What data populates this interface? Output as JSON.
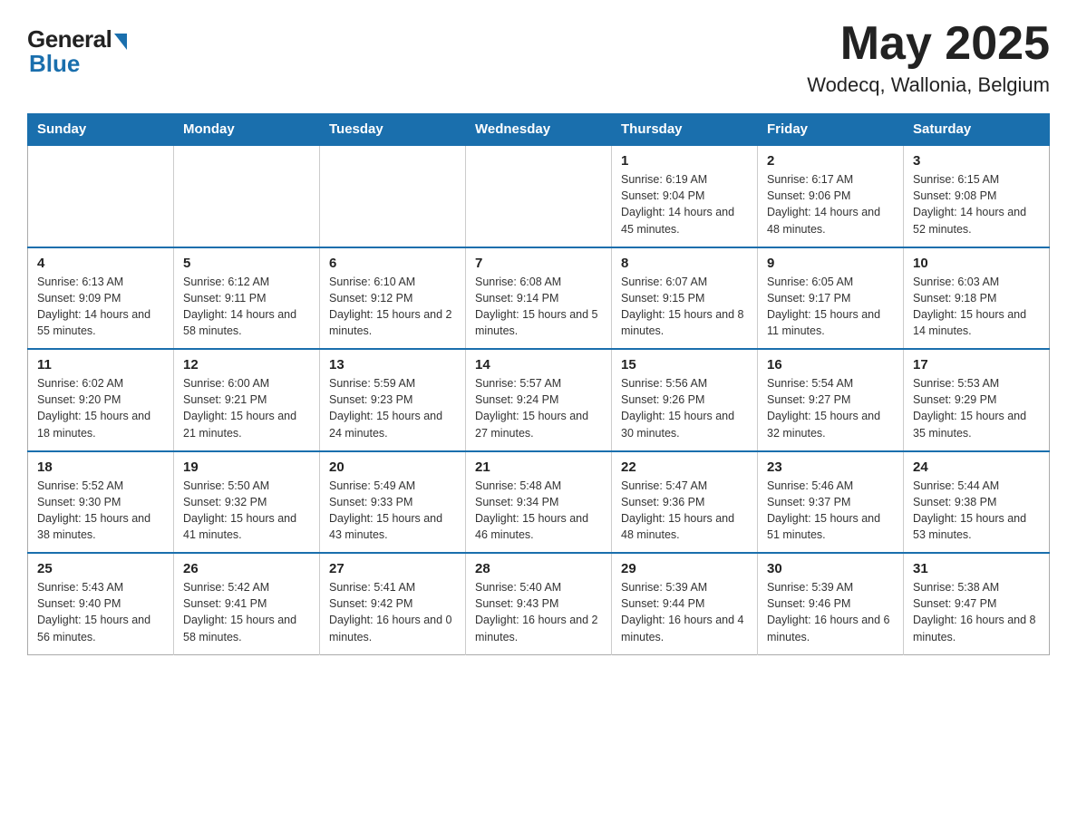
{
  "logo": {
    "general": "General",
    "blue": "Blue"
  },
  "title": {
    "month": "May 2025",
    "location": "Wodecq, Wallonia, Belgium"
  },
  "weekdays": [
    "Sunday",
    "Monday",
    "Tuesday",
    "Wednesday",
    "Thursday",
    "Friday",
    "Saturday"
  ],
  "weeks": [
    [
      {
        "day": "",
        "info": ""
      },
      {
        "day": "",
        "info": ""
      },
      {
        "day": "",
        "info": ""
      },
      {
        "day": "",
        "info": ""
      },
      {
        "day": "1",
        "info": "Sunrise: 6:19 AM\nSunset: 9:04 PM\nDaylight: 14 hours and 45 minutes."
      },
      {
        "day": "2",
        "info": "Sunrise: 6:17 AM\nSunset: 9:06 PM\nDaylight: 14 hours and 48 minutes."
      },
      {
        "day": "3",
        "info": "Sunrise: 6:15 AM\nSunset: 9:08 PM\nDaylight: 14 hours and 52 minutes."
      }
    ],
    [
      {
        "day": "4",
        "info": "Sunrise: 6:13 AM\nSunset: 9:09 PM\nDaylight: 14 hours and 55 minutes."
      },
      {
        "day": "5",
        "info": "Sunrise: 6:12 AM\nSunset: 9:11 PM\nDaylight: 14 hours and 58 minutes."
      },
      {
        "day": "6",
        "info": "Sunrise: 6:10 AM\nSunset: 9:12 PM\nDaylight: 15 hours and 2 minutes."
      },
      {
        "day": "7",
        "info": "Sunrise: 6:08 AM\nSunset: 9:14 PM\nDaylight: 15 hours and 5 minutes."
      },
      {
        "day": "8",
        "info": "Sunrise: 6:07 AM\nSunset: 9:15 PM\nDaylight: 15 hours and 8 minutes."
      },
      {
        "day": "9",
        "info": "Sunrise: 6:05 AM\nSunset: 9:17 PM\nDaylight: 15 hours and 11 minutes."
      },
      {
        "day": "10",
        "info": "Sunrise: 6:03 AM\nSunset: 9:18 PM\nDaylight: 15 hours and 14 minutes."
      }
    ],
    [
      {
        "day": "11",
        "info": "Sunrise: 6:02 AM\nSunset: 9:20 PM\nDaylight: 15 hours and 18 minutes."
      },
      {
        "day": "12",
        "info": "Sunrise: 6:00 AM\nSunset: 9:21 PM\nDaylight: 15 hours and 21 minutes."
      },
      {
        "day": "13",
        "info": "Sunrise: 5:59 AM\nSunset: 9:23 PM\nDaylight: 15 hours and 24 minutes."
      },
      {
        "day": "14",
        "info": "Sunrise: 5:57 AM\nSunset: 9:24 PM\nDaylight: 15 hours and 27 minutes."
      },
      {
        "day": "15",
        "info": "Sunrise: 5:56 AM\nSunset: 9:26 PM\nDaylight: 15 hours and 30 minutes."
      },
      {
        "day": "16",
        "info": "Sunrise: 5:54 AM\nSunset: 9:27 PM\nDaylight: 15 hours and 32 minutes."
      },
      {
        "day": "17",
        "info": "Sunrise: 5:53 AM\nSunset: 9:29 PM\nDaylight: 15 hours and 35 minutes."
      }
    ],
    [
      {
        "day": "18",
        "info": "Sunrise: 5:52 AM\nSunset: 9:30 PM\nDaylight: 15 hours and 38 minutes."
      },
      {
        "day": "19",
        "info": "Sunrise: 5:50 AM\nSunset: 9:32 PM\nDaylight: 15 hours and 41 minutes."
      },
      {
        "day": "20",
        "info": "Sunrise: 5:49 AM\nSunset: 9:33 PM\nDaylight: 15 hours and 43 minutes."
      },
      {
        "day": "21",
        "info": "Sunrise: 5:48 AM\nSunset: 9:34 PM\nDaylight: 15 hours and 46 minutes."
      },
      {
        "day": "22",
        "info": "Sunrise: 5:47 AM\nSunset: 9:36 PM\nDaylight: 15 hours and 48 minutes."
      },
      {
        "day": "23",
        "info": "Sunrise: 5:46 AM\nSunset: 9:37 PM\nDaylight: 15 hours and 51 minutes."
      },
      {
        "day": "24",
        "info": "Sunrise: 5:44 AM\nSunset: 9:38 PM\nDaylight: 15 hours and 53 minutes."
      }
    ],
    [
      {
        "day": "25",
        "info": "Sunrise: 5:43 AM\nSunset: 9:40 PM\nDaylight: 15 hours and 56 minutes."
      },
      {
        "day": "26",
        "info": "Sunrise: 5:42 AM\nSunset: 9:41 PM\nDaylight: 15 hours and 58 minutes."
      },
      {
        "day": "27",
        "info": "Sunrise: 5:41 AM\nSunset: 9:42 PM\nDaylight: 16 hours and 0 minutes."
      },
      {
        "day": "28",
        "info": "Sunrise: 5:40 AM\nSunset: 9:43 PM\nDaylight: 16 hours and 2 minutes."
      },
      {
        "day": "29",
        "info": "Sunrise: 5:39 AM\nSunset: 9:44 PM\nDaylight: 16 hours and 4 minutes."
      },
      {
        "day": "30",
        "info": "Sunrise: 5:39 AM\nSunset: 9:46 PM\nDaylight: 16 hours and 6 minutes."
      },
      {
        "day": "31",
        "info": "Sunrise: 5:38 AM\nSunset: 9:47 PM\nDaylight: 16 hours and 8 minutes."
      }
    ]
  ]
}
